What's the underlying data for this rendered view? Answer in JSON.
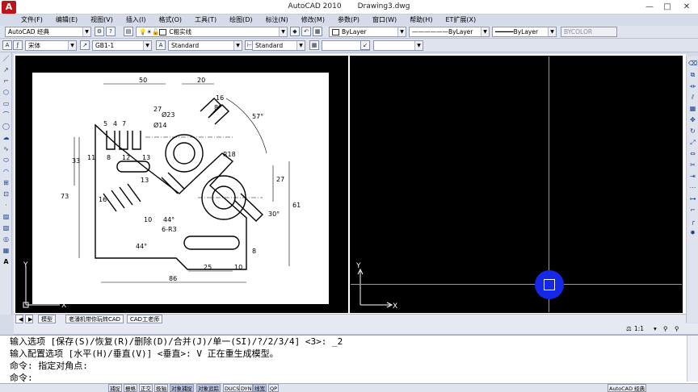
{
  "window": {
    "app_title": "AutoCAD 2010",
    "document_title": "Drawing3.dwg",
    "logo_letter": "A",
    "minimize": "—",
    "maximize": "□",
    "close": "✕"
  },
  "menu": [
    "文件(F)",
    "编辑(E)",
    "视图(V)",
    "插入(I)",
    "格式(O)",
    "工具(T)",
    "绘图(D)",
    "标注(N)",
    "修改(M)",
    "参数(P)",
    "窗口(W)",
    "帮助(H)",
    "ET扩展(X)"
  ],
  "toolbar1": {
    "workspace": "AutoCAD 经典",
    "layer": "C粗实线",
    "color": "ByLayer",
    "linetype": "ByLayer",
    "lineweight": "ByLayer",
    "plotstyle": "BYCOLOR"
  },
  "toolbar2": {
    "font": "宋体",
    "font_style": "GB1-1",
    "text_style": "Standard",
    "dim_style": "Standard"
  },
  "drawing": {
    "dims": {
      "d50": "50",
      "d20": "20",
      "d16": "16",
      "d8a": "8",
      "d27a": "27",
      "d57": "57°",
      "d5": "5",
      "d4": "4",
      "d7": "7",
      "d14": "Ø14",
      "d23": "Ø23",
      "d8b": "8",
      "d12": "12",
      "d13a": "13",
      "d11": "11",
      "d33": "33",
      "r18": "R18",
      "d27b": "27",
      "d73": "73",
      "d61": "61",
      "d13b": "13",
      "d16b": "16",
      "d10a": "10",
      "d44a": "44°",
      "r3": "6-R3",
      "d30": "30°",
      "d44b": "44°",
      "d8c": "8",
      "d25": "25",
      "d10b": "10",
      "d86": "86"
    }
  },
  "ucs": {
    "x": "X",
    "y": "Y"
  },
  "tabs": [
    "模型",
    "老潘机带你玩转CAD",
    "CAD工老师"
  ],
  "scale": "1:1",
  "command_lines": [
    "输入选项 [保存(S)/恢复(R)/删除(D)/合并(J)/单一(SI)/?/2/3/4] <3>: _2",
    "输入配置选项 [水平(H)/垂直(V)] <垂直>: V 正在重生成模型。",
    "命令: 指定对角点:",
    "命令:"
  ],
  "status_buttons": [
    {
      "label": "捕捉",
      "on": false
    },
    {
      "label": "栅格",
      "on": false
    },
    {
      "label": "正交",
      "on": false
    },
    {
      "label": "极轴",
      "on": false
    },
    {
      "label": "对象捕捉",
      "on": true
    },
    {
      "label": "对象追踪",
      "on": true
    },
    {
      "label": "DUCS",
      "on": false
    },
    {
      "label": "DYN",
      "on": false
    },
    {
      "label": "线宽",
      "on": true
    },
    {
      "label": "QP",
      "on": false
    }
  ],
  "status_workspace": "AutoCAD 经典"
}
